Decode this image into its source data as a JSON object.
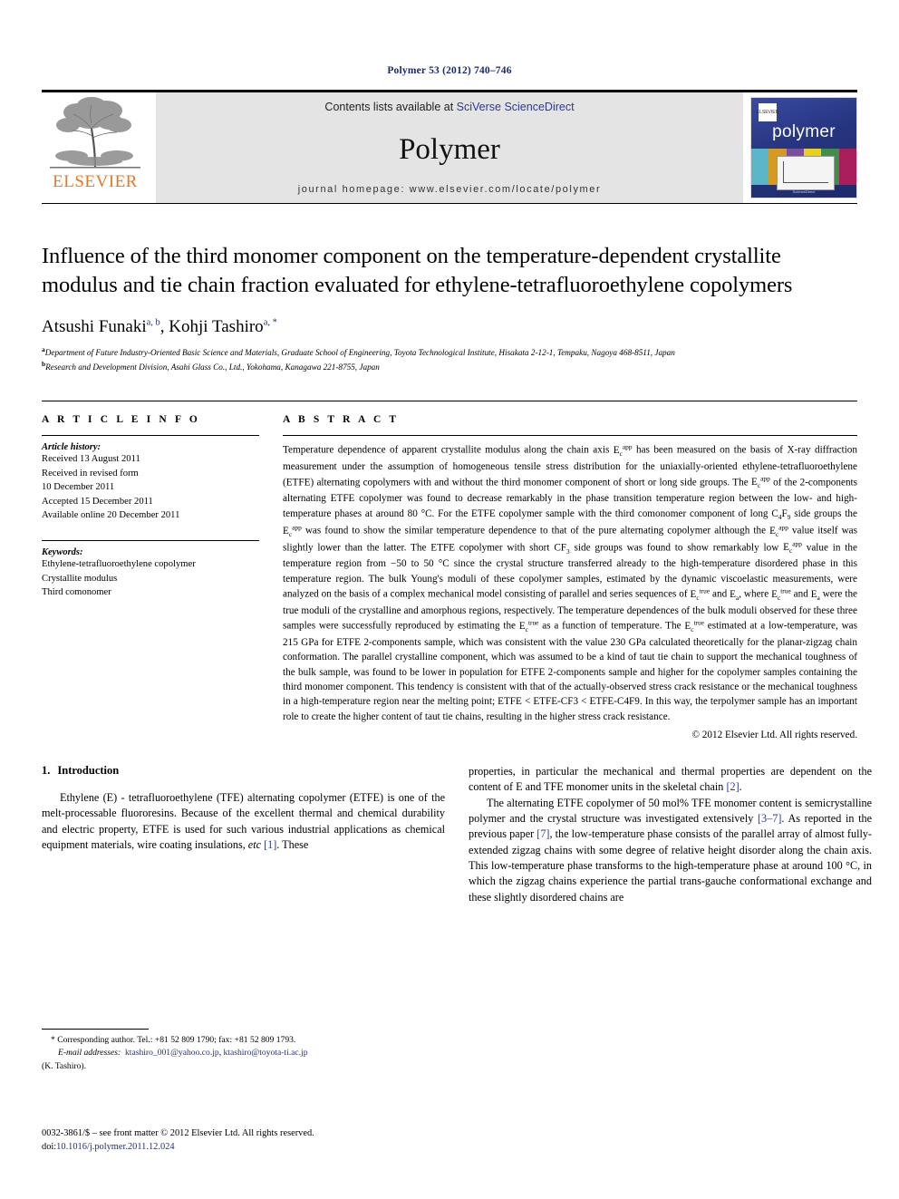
{
  "running_head": "Polymer 53 (2012) 740–746",
  "masthead": {
    "contents_prefix": "Contents lists available at ",
    "contents_link": "SciVerse ScienceDirect",
    "journal_name": "Polymer",
    "homepage": "journal homepage: www.elsevier.com/locate/polymer",
    "publisher_name": "ELSEVIER",
    "cover": {
      "title": "polymer",
      "badge": "ELSEVIER",
      "footer": "ScienceDirect"
    }
  },
  "article": {
    "title": "Influence of the third monomer component on the temperature-dependent crystallite modulus and tie chain fraction evaluated for ethylene-tetrafluoroethylene copolymers",
    "authors": [
      {
        "name": "Atsushi Funaki",
        "marks": "a, b"
      },
      {
        "name": "Kohji Tashiro",
        "marks": "a, *"
      }
    ],
    "affiliations": [
      {
        "mark": "a",
        "text": "Department of Future Industry-Oriented Basic Science and Materials, Graduate School of Engineering, Toyota Technological Institute, Hisakata 2-12-1, Tempaku, Nagoya 468-8511, Japan"
      },
      {
        "mark": "b",
        "text": "Research and Development Division, Asahi Glass Co., Ltd., Yokohama, Kanagawa 221-8755, Japan"
      }
    ]
  },
  "article_info": {
    "heading": "A R T I C L E   I N F O",
    "history_label": "Article history:",
    "history": [
      "Received 13 August 2011",
      "Received in revised form",
      "10 December 2011",
      "Accepted 15 December 2011",
      "Available online 20 December 2011"
    ],
    "keywords_label": "Keywords:",
    "keywords": [
      "Ethylene-tetrafluoroethylene copolymer",
      "Crystallite modulus",
      "Third comonomer"
    ]
  },
  "abstract": {
    "heading": "A B S T R A C T",
    "text_parts": [
      "Temperature dependence of apparent crystallite modulus along the chain axis ",
      " has been measured on the basis of X-ray diffraction measurement under the assumption of homogeneous tensile stress distribution for the uniaxially-oriented ethylene-tetrafluoroethylene (ETFE) alternating copolymers with and without the third monomer component of short or long side groups. The ",
      " of the 2-components alternating ETFE copolymer was found to decrease remarkably in the phase transition temperature region between the low- and high-temperature phases at around 80 °C. For the ETFE copolymer sample with the third comonomer component of long C",
      "F",
      " side groups the ",
      " was found to show the similar temperature dependence to that of the pure alternating copolymer although the ",
      " value itself was slightly lower than the latter. The ETFE copolymer with short CF",
      " side groups was found to show remarkably low ",
      " value in the temperature region from −50 to 50 °C since the crystal structure transferred already to the high-temperature disordered phase in this temperature region. The bulk Young's moduli of these copolymer samples, estimated by the dynamic viscoelastic measurements, were analyzed on the basis of a complex mechanical model consisting of parallel and series sequences of ",
      " and ",
      ", where ",
      " and ",
      " were the true moduli of the crystalline and amorphous regions, respectively. The temperature dependences of the bulk moduli observed for these three samples were successfully reproduced by estimating the ",
      " as a function of temperature. The ",
      " estimated at a low-temperature, was 215 GPa for ETFE 2-components sample, which was consistent with the value 230 GPa calculated theoretically for the planar-zigzag chain conformation. The parallel crystalline component, which was assumed to be a kind of taut tie chain to support the mechanical toughness of the bulk sample, was found to be lower in population for ETFE 2-components sample and higher for the copolymer samples containing the third monomer component. This tendency is consistent with that of the actually-observed stress crack resistance or the mechanical toughness in a high-temperature region near the melting point; ETFE < ETFE-CF3 < ETFE-C4F9. In this way, the terpolymer sample has an important role to create the higher content of taut tie chains, resulting in the higher stress crack resistance."
    ],
    "symbols": {
      "E_base": "E",
      "sub_c": "c",
      "sup_app": "app",
      "sup_true": "true",
      "sub_a": "a",
      "c4f9_four": "4",
      "c4f9_nine": "9",
      "cf3_three": "3"
    },
    "copyright": "© 2012 Elsevier Ltd. All rights reserved."
  },
  "body": {
    "section_number": "1.",
    "section_title": "Introduction",
    "left_paragraphs": [
      "Ethylene (E) - tetrafluoroethylene (TFE) alternating copolymer (ETFE) is one of the melt-processable fluororesins. Because of the excellent thermal and chemical durability and electric property, ETFE is used for such various industrial applications as chemical equipment materials, wire coating insulations, etc [1]. These"
    ],
    "left_p1_pre": "Ethylene (E) - tetrafluoroethylene (TFE) alternating copolymer (ETFE) is one of the melt-processable fluororesins. Because of the excellent thermal and chemical durability and electric property, ETFE is used for such various industrial applications as chemical equipment materials, wire coating insulations, ",
    "left_p1_italic": "etc",
    "left_p1_cite": "[1]",
    "left_p1_post": ". These",
    "right_p1_pre": "properties, in particular the mechanical and thermal properties are dependent on the content of E and TFE monomer units in the skeletal chain ",
    "right_p1_cite": "[2]",
    "right_p1_post": ".",
    "right_p2_pre": "The alternating ETFE copolymer of 50 mol% TFE monomer content is semicrystalline polymer and the crystal structure was investigated extensively ",
    "right_p2_cite1": "[3–7]",
    "right_p2_mid": ". As reported in the previous paper ",
    "right_p2_cite2": "[7]",
    "right_p2_post": ", the low-temperature phase consists of the parallel array of almost fully-extended zigzag chains with some degree of relative height disorder along the chain axis. This low-temperature phase transforms to the high-temperature phase at around 100 °C, in which the zigzag chains experience the partial trans-gauche conformational exchange and these slightly disordered chains are"
  },
  "footnotes": {
    "corresponding_pre": "* Corresponding author. Tel.: +81 52 809 1790; fax: +81 52 809 1793.",
    "email_label": "E-mail addresses:",
    "email1": "ktashiro_001@yahoo.co.jp",
    "email_sep": ", ",
    "email2": "ktashiro@toyota-ti.ac.jp",
    "email_post": "(K. Tashiro)."
  },
  "footer": {
    "issn_line": "0032-3861/$ – see front matter © 2012 Elsevier Ltd. All rights reserved.",
    "doi_label": "doi:",
    "doi_value": "10.1016/j.polymer.2011.12.024"
  }
}
